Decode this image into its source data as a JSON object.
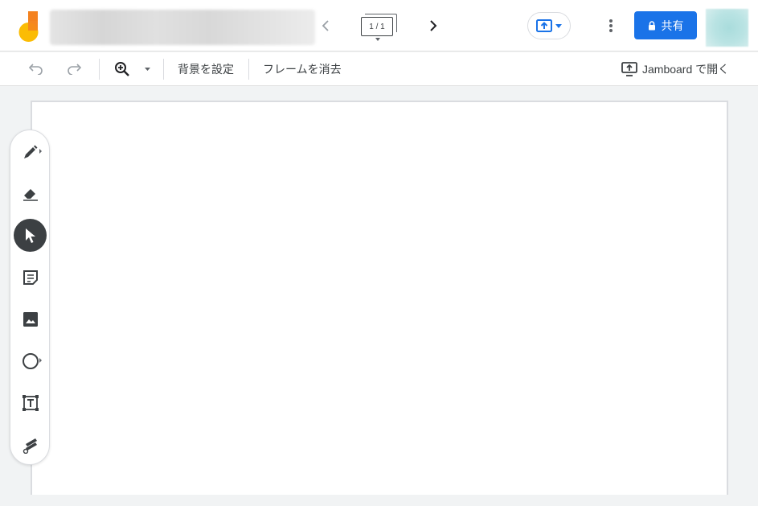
{
  "app": {
    "document_title": ""
  },
  "topbar": {
    "frame_counter": "1 / 1",
    "share_label": "共有",
    "icons": [
      "jamboard-logo-icon",
      "chevron-left-icon",
      "frames-icon",
      "chevron-right-icon",
      "present-icon",
      "more-vert-icon",
      "lock-icon"
    ]
  },
  "toolbar": {
    "set_background_label": "背景を設定",
    "clear_frame_label": "フレームを消去",
    "open_in_jamboard_label": "Jamboard で開く",
    "icons": [
      "undo-icon",
      "redo-icon",
      "zoom-in-icon",
      "caret-down-icon",
      "open-in-jamboard-icon"
    ]
  },
  "tools": [
    {
      "name": "pen",
      "icon": "pen-icon",
      "has_submenu": true
    },
    {
      "name": "eraser",
      "icon": "eraser-icon",
      "has_submenu": false
    },
    {
      "name": "select",
      "icon": "select-cursor-icon",
      "has_submenu": false,
      "active": true
    },
    {
      "name": "sticky-note",
      "icon": "sticky-note-icon",
      "has_submenu": false
    },
    {
      "name": "image",
      "icon": "image-icon",
      "has_submenu": false
    },
    {
      "name": "shape",
      "icon": "circle-icon",
      "has_submenu": true
    },
    {
      "name": "text-box",
      "icon": "text-box-icon",
      "has_submenu": false
    },
    {
      "name": "laser",
      "icon": "laser-icon",
      "has_submenu": false
    }
  ],
  "colors": {
    "accent": "#1a73e8",
    "active_tool": "#3c4043",
    "logo_orange": "#f4821f",
    "logo_yellow": "#fbbc04",
    "background": "#f1f3f4"
  }
}
